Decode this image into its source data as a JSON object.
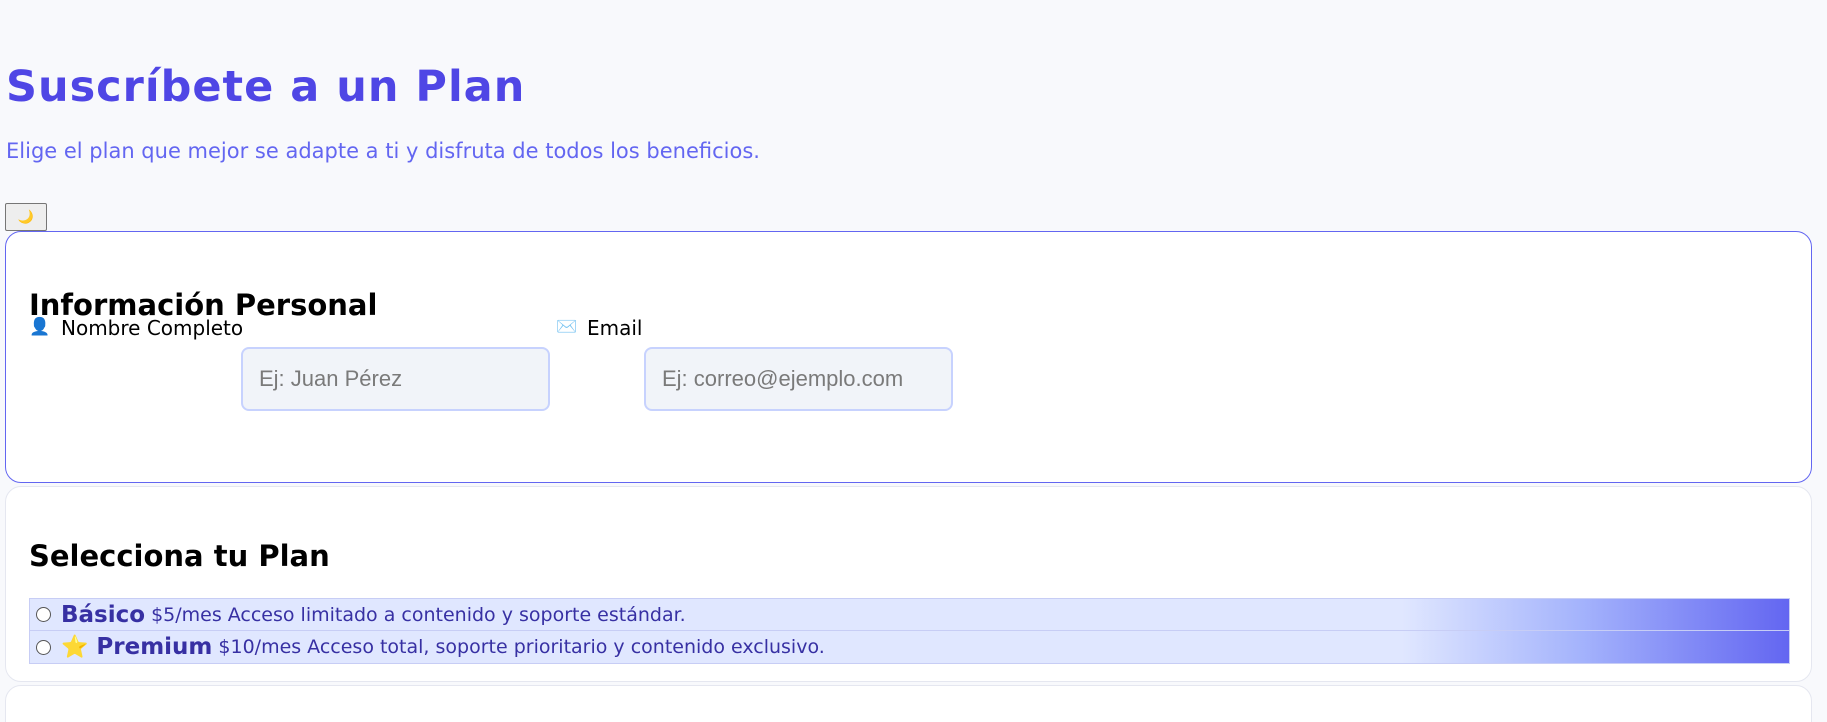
{
  "header": {
    "title": "Suscríbete a un Plan",
    "subtitle": "Elige el plan que mejor se adapte a ti y disfruta de todos los beneficios.",
    "theme_toggle_icon": "🌙"
  },
  "personal": {
    "title": "Información Personal",
    "name_icon": "👤",
    "name_label": "Nombre Completo",
    "name_value": "",
    "name_placeholder": "Ej: Juan Pérez",
    "email_icon": "✉️",
    "email_label": "Email",
    "email_value": "",
    "email_placeholder": "Ej: correo@ejemplo.com"
  },
  "plans": {
    "title": "Selecciona tu Plan",
    "items": [
      {
        "icon": "",
        "name": "Básico",
        "price": "$5/mes",
        "description": "Acceso limitado a contenido y soporte estándar.",
        "selected": false
      },
      {
        "icon": "⭐",
        "name": "Premium",
        "price": "$10/mes",
        "description": "Acceso total, soporte prioritario y contenido exclusivo.",
        "selected": false
      }
    ]
  },
  "colors": {
    "accent": "#4f46e5",
    "accent_light": "#6366f1",
    "plan_bg": "#e0e7ff",
    "input_bg": "#f1f4f9",
    "input_border": "#c7d2fe"
  }
}
